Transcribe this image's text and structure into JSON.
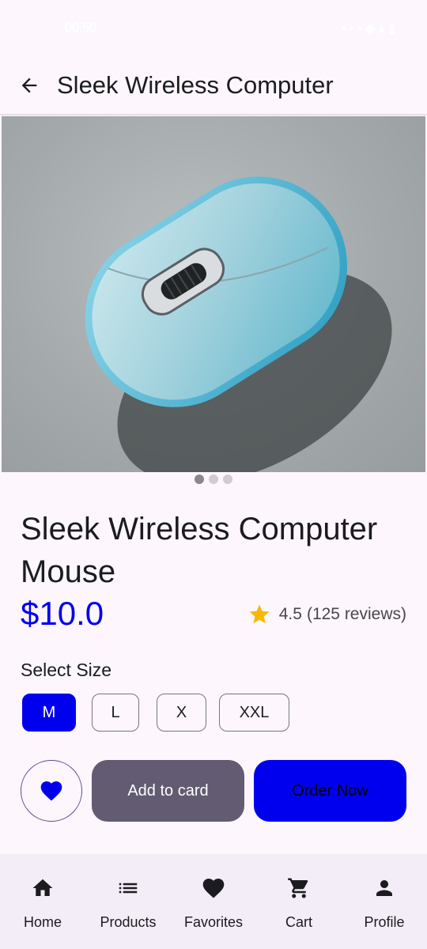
{
  "status_bar": {
    "time": "00:50",
    "icons": "▪ ▪ ▪ ◆ ▴ ▮"
  },
  "app_bar": {
    "title": "Sleek Wireless Computer"
  },
  "product": {
    "name": "Sleek Wireless Computer Mouse",
    "price": "$10.0",
    "rating": "4.5",
    "reviews": "(125 reviews)",
    "image_icon": "wireless-mouse-photo",
    "carousel_dots": 3,
    "carousel_active_index": 0
  },
  "size": {
    "label": "Select Size",
    "options": [
      "M",
      "L",
      "X",
      "XXL"
    ],
    "selected": "M"
  },
  "actions": {
    "favorite_icon": "heart-icon",
    "add_to_cart": "Add to card",
    "order_now": "Order Now"
  },
  "bottom_nav": {
    "items": [
      {
        "label": "Home",
        "icon": "home-icon"
      },
      {
        "label": "Products",
        "icon": "list-icon"
      },
      {
        "label": "Favorites",
        "icon": "heart-icon"
      },
      {
        "label": "Cart",
        "icon": "cart-icon"
      },
      {
        "label": "Profile",
        "icon": "person-icon"
      }
    ]
  },
  "colors": {
    "accent": "#0000ee",
    "secondary_button": "#625b71",
    "background": "#fdf7fd",
    "nav_background": "#f3edf7",
    "star": "#f9b800"
  }
}
